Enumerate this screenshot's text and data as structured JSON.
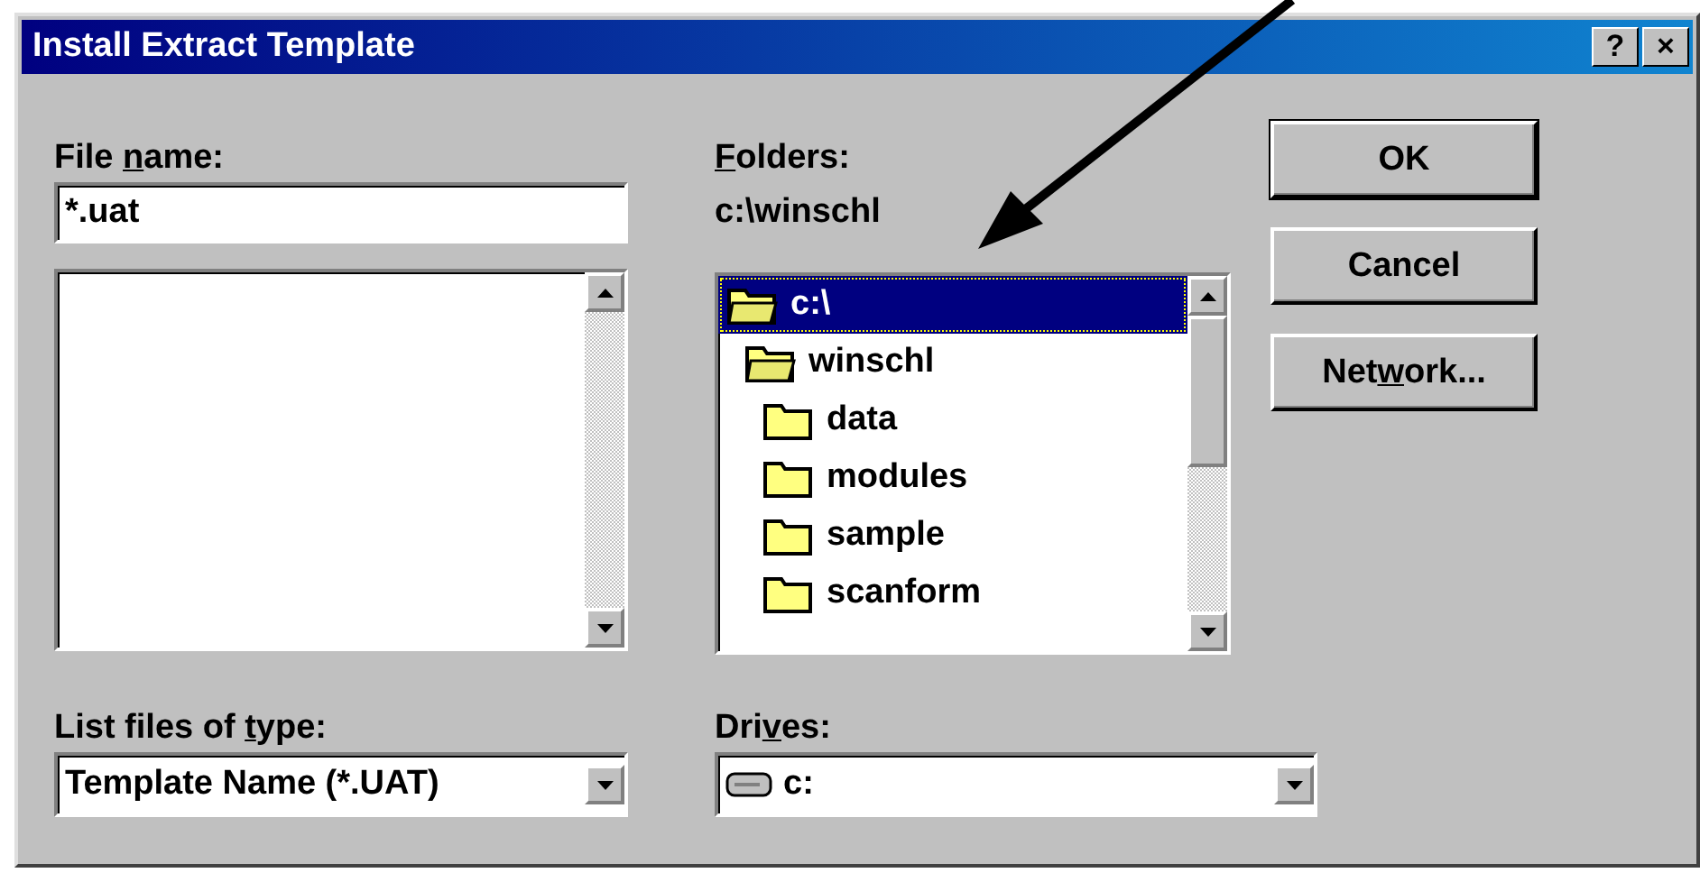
{
  "window": {
    "title": "Install Extract Template",
    "title_buttons": [
      "?",
      "×"
    ]
  },
  "file_name": {
    "label": {
      "before": "File ",
      "key": "n",
      "after": "ame:"
    },
    "value": "*.uat"
  },
  "folders": {
    "label": {
      "key": "F",
      "after": "olders:"
    },
    "path": "c:\\winschl",
    "tree": [
      {
        "name": "c:\\",
        "selected": true,
        "expanded": true,
        "children": [
          {
            "name": "winschl",
            "selected": false,
            "expanded": true,
            "children": [
              {
                "name": "data",
                "selected": false,
                "expanded": false
              },
              {
                "name": "modules",
                "selected": false,
                "expanded": false
              },
              {
                "name": "sample",
                "selected": false,
                "expanded": false
              },
              {
                "name": "scanform",
                "selected": false,
                "expanded": false
              }
            ]
          }
        ]
      }
    ]
  },
  "file_type": {
    "label": {
      "before": "List files of ",
      "key": "t",
      "after": "ype:"
    },
    "value": "Template Name (*.UAT)"
  },
  "drives": {
    "label": {
      "before": "Dri",
      "key": "v",
      "after": "es:"
    },
    "value": "c:"
  },
  "buttons": [
    {
      "after": "OK"
    },
    {
      "after": "Cancel"
    },
    {
      "before": "Net",
      "key": "w",
      "after": "ork..."
    }
  ]
}
